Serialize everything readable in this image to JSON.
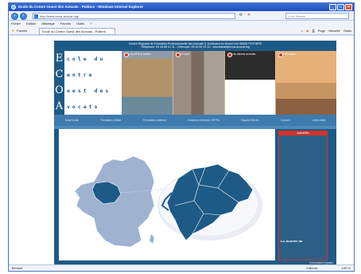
{
  "window": {
    "title": "Ecole du Centre Ouest des Avocats - Poitiers - Windows Internet Explorer"
  },
  "address": {
    "url": "http://www.ecoa-avocat.org/",
    "search_placeholder": "Live Search"
  },
  "menu": [
    "Fichier",
    "Edition",
    "Affichage",
    "Favoris",
    "Outils",
    "?"
  ],
  "favorites_label": "Favoris",
  "tab_label": "Ecole du Centre Ouest des Avocats - Poitiers",
  "toolbar": [
    "Page",
    "Sécurité",
    "Outils"
  ],
  "status": {
    "left": "Terminé",
    "zone": "Internet",
    "zoom": "100 %"
  },
  "site": {
    "header_lines": [
      "Centre Régional de Formation Professionnelle des Avocats 9, boulevard du Grand Cerf 86000 POITIERS",
      "Téléphone: 05 49 88 01 11 - Télécopie: 05 49 51 23 10 - secretariat@ecoa-avocat.org"
    ],
    "logo_letters": [
      "E",
      "C",
      "O",
      "A"
    ],
    "logo_words": [
      "cole du",
      "entre",
      "uest des",
      "vocats"
    ],
    "photo_labels": [
      "Les EFB & écoles",
      "L'Ecole",
      "Les élèves avocats",
      "Formation"
    ],
    "nav": [
      "Notre école",
      "Formation initiale",
      "Formation continue",
      "Examens d'entrée CRFPA",
      "Espace élèves",
      "Contact",
      "Liens utiles"
    ],
    "sidebar_title": "Actualités",
    "sidebar_news": "La Journée du",
    "sidebar_more": "",
    "credit": "Informations légales"
  }
}
